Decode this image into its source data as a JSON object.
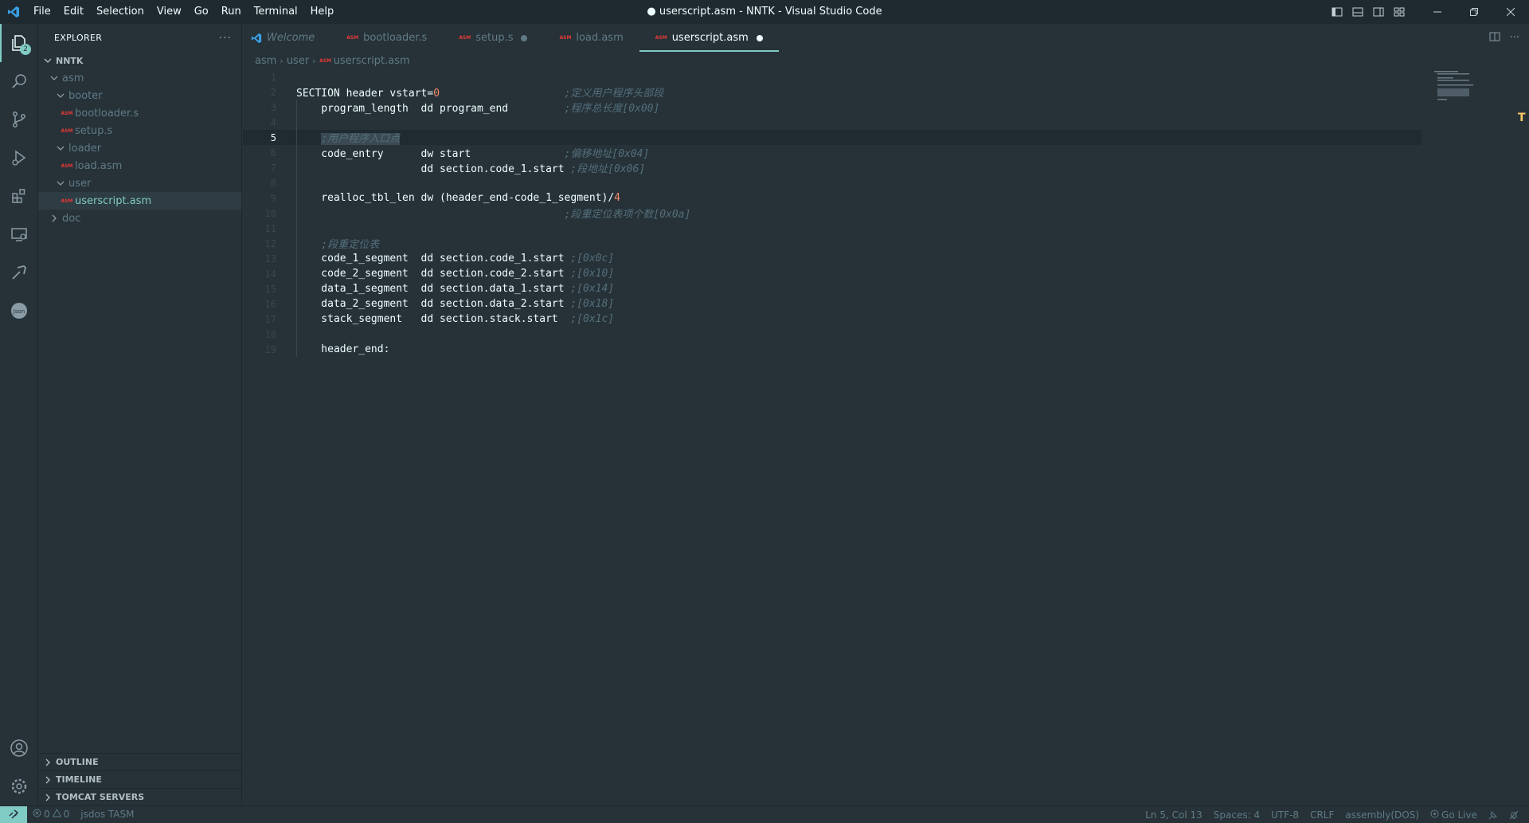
{
  "window": {
    "title": "● userscript.asm - NNTK - Visual Studio Code",
    "menu": [
      "File",
      "Edit",
      "Selection",
      "View",
      "Go",
      "Run",
      "Terminal",
      "Help"
    ]
  },
  "activity": {
    "explorer_badge": "2"
  },
  "sidebar": {
    "title": "EXPLORER",
    "more": "···",
    "root": "NNTK",
    "tree": [
      {
        "label": "asm",
        "type": "folder",
        "depth": 1,
        "open": true
      },
      {
        "label": "booter",
        "type": "folder",
        "depth": 2,
        "open": true
      },
      {
        "label": "bootloader.s",
        "type": "file",
        "depth": 3
      },
      {
        "label": "setup.s",
        "type": "file",
        "depth": 3
      },
      {
        "label": "loader",
        "type": "folder",
        "depth": 2,
        "open": true
      },
      {
        "label": "load.asm",
        "type": "file",
        "depth": 3
      },
      {
        "label": "user",
        "type": "folder",
        "depth": 2,
        "open": true
      },
      {
        "label": "userscript.asm",
        "type": "file",
        "depth": 3,
        "selected": true
      },
      {
        "label": "doc",
        "type": "folder",
        "depth": 1,
        "open": false
      }
    ],
    "panels": [
      "OUTLINE",
      "TIMELINE",
      "TOMCAT SERVERS"
    ]
  },
  "tabs": [
    {
      "label": "Welcome",
      "italic": true,
      "icon": "vscode-icon"
    },
    {
      "label": "bootloader.s",
      "icon": "asm-icon"
    },
    {
      "label": "setup.s",
      "icon": "asm-icon",
      "dirty": true
    },
    {
      "label": "load.asm",
      "icon": "asm-icon"
    },
    {
      "label": "userscript.asm",
      "icon": "asm-icon",
      "dirty": true,
      "active": true
    }
  ],
  "breadcrumb": [
    "asm",
    "user",
    "userscript.asm"
  ],
  "editor": {
    "current_line": 5,
    "lines": [
      {
        "n": "1",
        "code": "",
        "comment": ""
      },
      {
        "n": "2",
        "code": "SECTION header vstart=",
        "num": "0",
        "pad": "                    ",
        "comment": ";定义用户程序头部段"
      },
      {
        "n": "3",
        "code": "    program_length  dd program_end         ",
        "comment": ";程序总长度[0x00]"
      },
      {
        "n": "4",
        "code": "",
        "comment": ""
      },
      {
        "n": "5",
        "code": "    ",
        "comment": ";用户程序入口点",
        "highlight": true
      },
      {
        "n": "6",
        "code": "    code_entry      dw start               ",
        "comment": ";偏移地址[0x04]"
      },
      {
        "n": "7",
        "code": "                    dd section.code_1.start ",
        "comment": ";段地址[0x06]"
      },
      {
        "n": "8",
        "code": "",
        "comment": ""
      },
      {
        "n": "9",
        "code": "    realloc_tbl_len dw (header_end-code_1_segment)/",
        "num": "4",
        "comment": ""
      },
      {
        "n": "10",
        "code": "                                           ",
        "comment": ";段重定位表项个数[0x0a]"
      },
      {
        "n": "11",
        "code": "",
        "comment": ""
      },
      {
        "n": "12",
        "code": "    ",
        "comment": ";段重定位表"
      },
      {
        "n": "13",
        "code": "    code_1_segment  dd section.code_1.start ",
        "comment": ";[0x0c]"
      },
      {
        "n": "14",
        "code": "    code_2_segment  dd section.code_2.start ",
        "comment": ";[0x10]"
      },
      {
        "n": "15",
        "code": "    data_1_segment  dd section.data_1.start ",
        "comment": ";[0x14]"
      },
      {
        "n": "16",
        "code": "    data_2_segment  dd section.data_2.start ",
        "comment": ";[0x18]"
      },
      {
        "n": "17",
        "code": "    stack_segment   dd section.stack.start  ",
        "comment": ";[0x1c]"
      },
      {
        "n": "18",
        "code": "",
        "comment": ""
      },
      {
        "n": "19",
        "code": "    header_end:",
        "comment": ""
      }
    ]
  },
  "status": {
    "errors": "0",
    "warnings": "0",
    "tasm": "jsdos TASM",
    "position": "Ln 5, Col 13",
    "spaces": "Spaces: 4",
    "encoding": "UTF-8",
    "eol": "CRLF",
    "language": "assembly(DOS)",
    "golive": "Go Live"
  },
  "colors": {
    "accent": "#80cbc4",
    "background": "#263238",
    "comment": "#546e7a",
    "number": "#f78c6c",
    "asm_icon": "#e53935"
  }
}
